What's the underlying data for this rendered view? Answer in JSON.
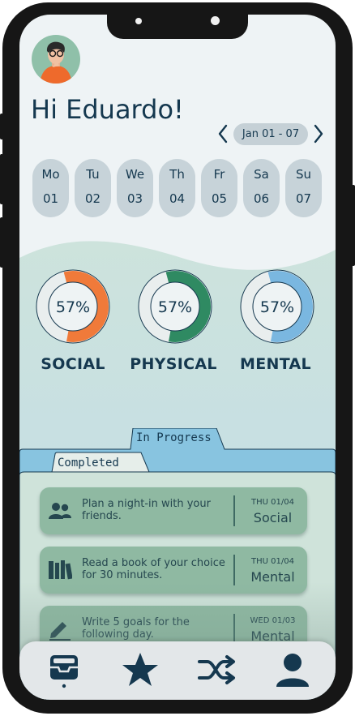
{
  "user": {
    "greeting": "Hi Eduardo!",
    "avatar_alt": "user avatar"
  },
  "date_nav": {
    "prev_icon": "chevron-left-icon",
    "next_icon": "chevron-right-icon",
    "range": "Jan 01 - 07"
  },
  "days": [
    {
      "name": "Mo",
      "num": "01"
    },
    {
      "name": "Tu",
      "num": "02"
    },
    {
      "name": "We",
      "num": "03"
    },
    {
      "name": "Th",
      "num": "04"
    },
    {
      "name": "Fr",
      "num": "05"
    },
    {
      "name": "Sa",
      "num": "06"
    },
    {
      "name": "Su",
      "num": "07"
    }
  ],
  "progress": [
    {
      "label": "SOCIAL",
      "percent_text": "57%",
      "value": 0.57,
      "color": "#f07a3a"
    },
    {
      "label": "PHYSICAL",
      "percent_text": "57%",
      "value": 0.57,
      "color": "#2f8a62"
    },
    {
      "label": "MENTAL",
      "percent_text": "57%",
      "value": 0.57,
      "color": "#7ab7e0"
    }
  ],
  "tabs": {
    "in_progress": "In Progress",
    "completed": "Completed"
  },
  "tasks": [
    {
      "icon": "people-icon",
      "text": "Plan a night-in with your friends.",
      "date": "THU 01/04",
      "category": "Social"
    },
    {
      "icon": "books-icon",
      "text": "Read a book of your choice for 30 minutes.",
      "date": "THU 01/04",
      "category": "Mental"
    },
    {
      "icon": "pencil-icon",
      "text": "Write 5 goals for the following day.",
      "date": "WED 01/03",
      "category": "Mental"
    }
  ],
  "nav": [
    {
      "icon": "inbox-icon",
      "active": true
    },
    {
      "icon": "star-icon",
      "active": false
    },
    {
      "icon": "shuffle-icon",
      "active": false
    },
    {
      "icon": "person-icon",
      "active": false
    }
  ],
  "colors": {
    "primary_text": "#15384f",
    "folder_blue": "#88c4e0",
    "folder_green": "#cfe3da",
    "card_green": "#8fb9a2"
  }
}
